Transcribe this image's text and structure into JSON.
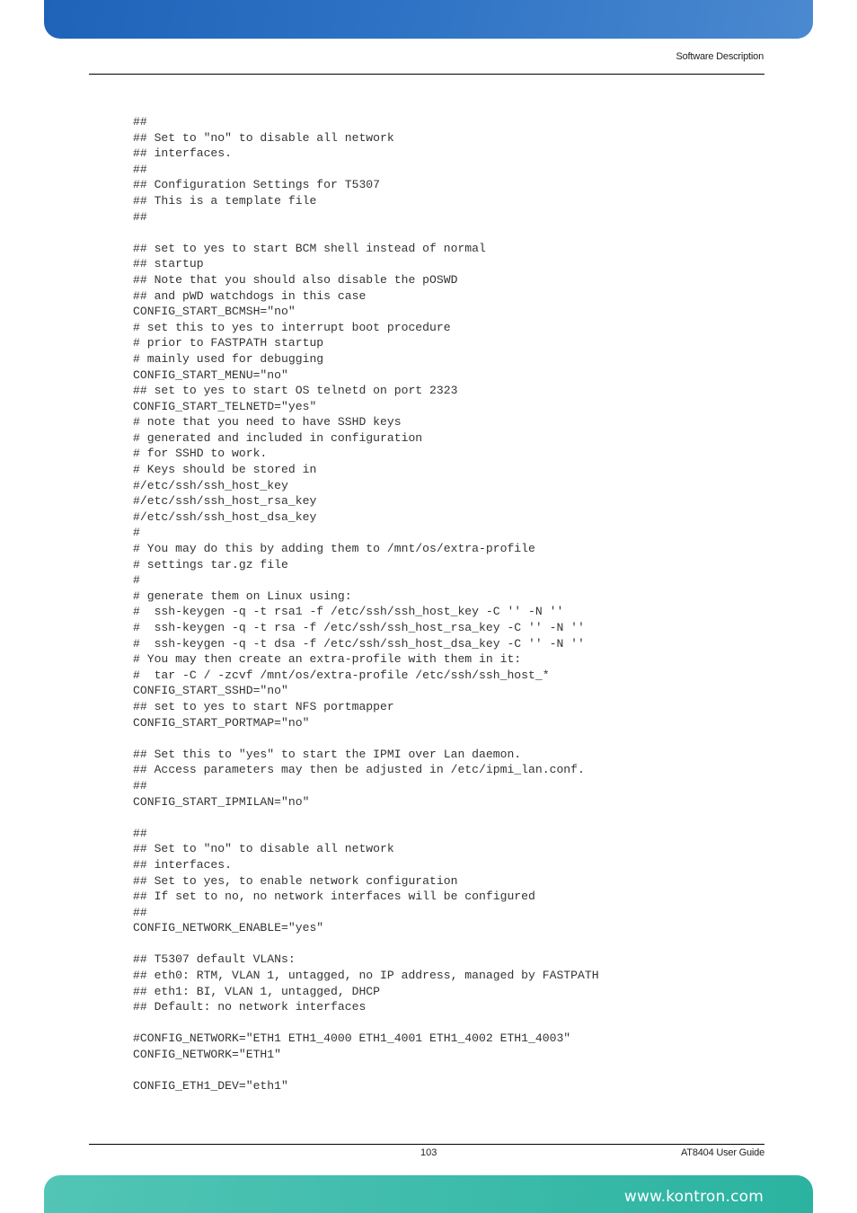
{
  "header": {
    "section_title": "Software Description"
  },
  "code_block": {
    "lines": [
      "##",
      "## Set to \"no\" to disable all network",
      "## interfaces.",
      "##",
      "## Configuration Settings for T5307",
      "## This is a template file",
      "##",
      "",
      "## set to yes to start BCM shell instead of normal",
      "## startup",
      "## Note that you should also disable the pOSWD",
      "## and pWD watchdogs in this case",
      "CONFIG_START_BCMSH=\"no\"",
      "# set this to yes to interrupt boot procedure",
      "# prior to FASTPATH startup",
      "# mainly used for debugging",
      "CONFIG_START_MENU=\"no\"",
      "## set to yes to start OS telnetd on port 2323",
      "CONFIG_START_TELNETD=\"yes\"",
      "# note that you need to have SSHD keys",
      "# generated and included in configuration",
      "# for SSHD to work.",
      "# Keys should be stored in",
      "#/etc/ssh/ssh_host_key",
      "#/etc/ssh/ssh_host_rsa_key",
      "#/etc/ssh/ssh_host_dsa_key",
      "#",
      "# You may do this by adding them to /mnt/os/extra-profile",
      "# settings tar.gz file",
      "#",
      "# generate them on Linux using:",
      "#  ssh-keygen -q -t rsa1 -f /etc/ssh/ssh_host_key -C '' -N ''",
      "#  ssh-keygen -q -t rsa -f /etc/ssh/ssh_host_rsa_key -C '' -N ''",
      "#  ssh-keygen -q -t dsa -f /etc/ssh/ssh_host_dsa_key -C '' -N ''",
      "# You may then create an extra-profile with them in it:",
      "#  tar -C / -zcvf /mnt/os/extra-profile /etc/ssh/ssh_host_*",
      "CONFIG_START_SSHD=\"no\"",
      "## set to yes to start NFS portmapper",
      "CONFIG_START_PORTMAP=\"no\"",
      "",
      "## Set this to \"yes\" to start the IPMI over Lan daemon.",
      "## Access parameters may then be adjusted in /etc/ipmi_lan.conf.",
      "##",
      "CONFIG_START_IPMILAN=\"no\"",
      "",
      "##",
      "## Set to \"no\" to disable all network",
      "## interfaces.",
      "## Set to yes, to enable network configuration",
      "## If set to no, no network interfaces will be configured",
      "##",
      "CONFIG_NETWORK_ENABLE=\"yes\"",
      "",
      "## T5307 default VLANs:",
      "## eth0: RTM, VLAN 1, untagged, no IP address, managed by FASTPATH",
      "## eth1: BI, VLAN 1, untagged, DHCP",
      "## Default: no network interfaces",
      "",
      "#CONFIG_NETWORK=\"ETH1 ETH1_4000 ETH1_4001 ETH1_4002 ETH1_4003\"",
      "CONFIG_NETWORK=\"ETH1\"",
      "",
      "CONFIG_ETH1_DEV=\"eth1\""
    ]
  },
  "footer": {
    "page_number": "103",
    "doc_title": "AT8404 User  Guide",
    "url": "www.kontron.com"
  },
  "colors": {
    "header_band": "#2d72c4",
    "footer_band": "#3fbcac",
    "text": "#333333"
  }
}
